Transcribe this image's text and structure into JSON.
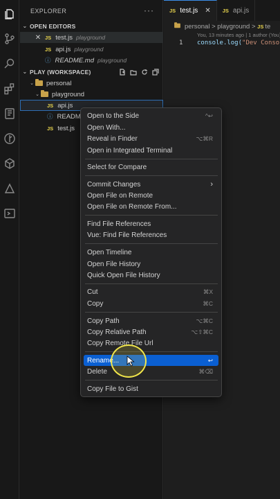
{
  "sidebar": {
    "title": "EXPLORER",
    "more": "···",
    "open_editors_header": "OPEN EDITORS",
    "open_editors": [
      {
        "close": "✕",
        "badge": "JS",
        "name": "test.js",
        "folder": "playground"
      },
      {
        "badge": "JS",
        "name": "api.js",
        "folder": "playground"
      },
      {
        "badge": "ⓘ",
        "name": "README.md",
        "folder": "playground"
      }
    ],
    "workspace_header": "PLAY (WORKSPACE)",
    "tree": {
      "root": "personal",
      "folder": "playground",
      "files": [
        {
          "badge": "JS",
          "name": "api.js"
        },
        {
          "badge": "ⓘ",
          "name": "READM"
        },
        {
          "badge": "JS",
          "name": "test.js"
        }
      ]
    }
  },
  "editor": {
    "tabs": [
      {
        "badge": "JS",
        "name": "test.js",
        "close": "✕"
      },
      {
        "badge": "JS",
        "name": "api.js"
      }
    ],
    "breadcrumb": {
      "parts": [
        "personal",
        "playground",
        "JS",
        "te"
      ],
      "separator": ">"
    },
    "blame": "You, 13 minutes ago | 1 author (You)",
    "code": {
      "line_number": "1",
      "fn": "console.log(",
      "str": "\"Dev Consol"
    }
  },
  "context_menu": {
    "items": [
      {
        "label": "Open to the Side",
        "shortcut": "^↩"
      },
      {
        "label": "Open With..."
      },
      {
        "label": "Reveal in Finder",
        "shortcut": "⌥⌘R"
      },
      {
        "label": "Open in Integrated Terminal"
      },
      {
        "label": "Select for Compare"
      },
      {
        "label": "Commit Changes",
        "shortcut": "›"
      },
      {
        "label": "Open File on Remote"
      },
      {
        "label": "Open File on Remote From..."
      },
      {
        "label": "Find File References"
      },
      {
        "label": "Vue: Find File References"
      },
      {
        "label": "Open Timeline"
      },
      {
        "label": "Open File History"
      },
      {
        "label": "Quick Open File History"
      },
      {
        "label": "Cut",
        "shortcut": "⌘X"
      },
      {
        "label": "Copy",
        "shortcut": "⌘C"
      },
      {
        "label": "Copy Path",
        "shortcut": "⌥⌘C"
      },
      {
        "label": "Copy Relative Path",
        "shortcut": "⌥⇧⌘C"
      },
      {
        "label": "Copy Remote File Url"
      },
      {
        "label": "Rename...",
        "shortcut": "↩"
      },
      {
        "label": "Delete",
        "shortcut": "⌘⌫"
      },
      {
        "label": "Copy File to Gist"
      }
    ]
  },
  "colors": {
    "accent": "#0a5fd2",
    "js_badge": "#e8d44d",
    "cursor_ring": "#f1e64a"
  }
}
